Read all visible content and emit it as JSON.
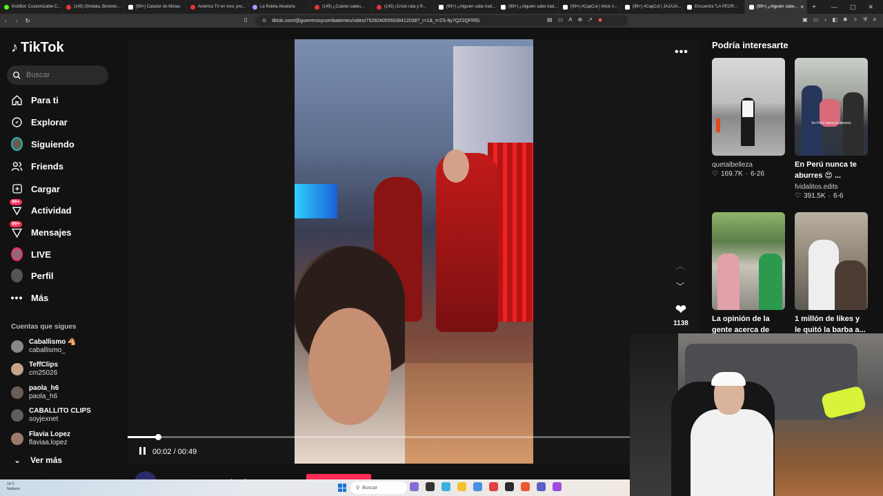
{
  "browser": {
    "tabs": [
      {
        "title": "KickBot: Customizable C...",
        "type": "kick"
      },
      {
        "title": "(145) Olvídala, Binomio ...",
        "type": "yt"
      },
      {
        "title": "(99+) Catador de Misias",
        "type": "tt"
      },
      {
        "title": "América TV en vivo: pro...",
        "type": "yt"
      },
      {
        "title": "La Ruleta Aleatoria",
        "type": "other"
      },
      {
        "title": "(145) ¿Cuánto sabes...",
        "type": "yt"
      },
      {
        "title": "(145) ¡Cristo rata y R...",
        "type": "yt"
      },
      {
        "title": "(99+) ¿Alguien sabe trad...",
        "type": "tt"
      },
      {
        "title": "(99+) ¿Alguien sabe trad...",
        "type": "tt"
      },
      {
        "title": "(99+) #CapCut | #kick #...",
        "type": "tt"
      },
      {
        "title": "(99+) #CapCut | JAJAJA...",
        "type": "tt"
      },
      {
        "title": "Encuentra \"LA PEOR...",
        "type": "tt"
      },
      {
        "title": "(99+) ¿Alguien sabe...",
        "type": "tt",
        "active": true
      }
    ],
    "new_tab": "+",
    "window_controls": [
      "—",
      "▢",
      "✕"
    ],
    "url": "tiktok.com/@guerrerosycombatientes/video/7528240555038412038?_r=1&_t=ZS-8y7QZ2QFRfG"
  },
  "sidebar": {
    "logo": "TikTok",
    "search_placeholder": "Buscar",
    "nav": [
      {
        "label": "Para ti",
        "icon": "home-icon"
      },
      {
        "label": "Explorar",
        "icon": "compass-icon"
      },
      {
        "label": "Siguiendo",
        "icon": "following-avatar-icon"
      },
      {
        "label": "Friends",
        "icon": "friends-icon"
      },
      {
        "label": "Cargar",
        "icon": "upload-icon"
      },
      {
        "label": "Actividad",
        "icon": "activity-icon",
        "badge": "99+"
      },
      {
        "label": "Mensajes",
        "icon": "messages-icon",
        "badge": "99+"
      },
      {
        "label": "LIVE",
        "icon": "live-icon"
      },
      {
        "label": "Perfil",
        "icon": "profile-icon"
      },
      {
        "label": "Más",
        "icon": "more-icon"
      }
    ],
    "following_title": "Cuentas que sigues",
    "accounts": [
      {
        "name": "Caballismo 🐴",
        "user": "caballismo_"
      },
      {
        "name": "TeffClips",
        "user": "cm25026"
      },
      {
        "name": "paola_h6",
        "user": "paola_h6"
      },
      {
        "name": "CABALLITO CLIPS",
        "user": "soyjexnet"
      },
      {
        "name": "Flavia Lopez",
        "user": "flaviaa.lopez"
      }
    ],
    "see_more": "Ver más"
  },
  "player": {
    "time": "00:02 / 00:49",
    "progress": 0.06,
    "likes": "1138",
    "author": "guerrerosycombatientes"
  },
  "recommendations": {
    "title": "Podría interesarte",
    "cards": [
      {
        "user": "quetalbelleza",
        "likes": "169.7K",
        "date": "6-26",
        "caption": "",
        "thumb_caption": ""
      },
      {
        "user": "fvidalitos.edits",
        "likes": "391.5K",
        "date": "6-6",
        "caption": "En Perú nunca te aburres 😍 ...",
        "thumb_caption": "En Perú nunca te aburres"
      },
      {
        "user": "",
        "likes": "",
        "date": "",
        "caption": "La opinión de la gente acerca de un...",
        "thumb_caption": ""
      },
      {
        "user": "",
        "likes": "",
        "date": "",
        "caption": "1 millón de likes y le quitó la barba a...",
        "thumb_caption": ""
      }
    ]
  },
  "taskbar": {
    "weather_temp": "16°C",
    "weather_desc": "Nublado",
    "search_placeholder": "Buscar"
  }
}
